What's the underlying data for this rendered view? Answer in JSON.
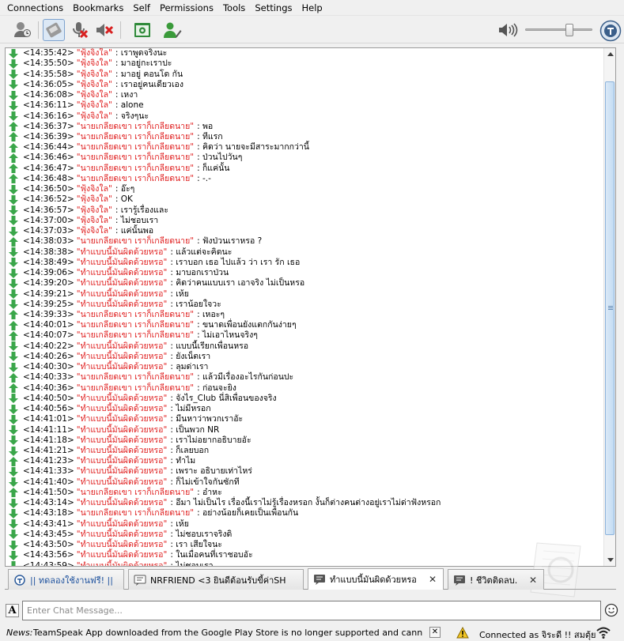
{
  "menu": [
    "Connections",
    "Bookmarks",
    "Self",
    "Permissions",
    "Tools",
    "Settings",
    "Help"
  ],
  "toolbar": {
    "buttons": [
      "away-icon",
      "push-to-talk-icon",
      "mute-mic-icon",
      "mute-speakers-icon",
      "channel-commander-icon",
      "avatar-icon"
    ],
    "volume_level": 0.68
  },
  "messages": [
    {
      "dir": "down",
      "time": "<14:35:42>",
      "nick": "\"ฟุ้งจิงใล\"",
      "text": ": เราพูดจริงนะ"
    },
    {
      "dir": "down",
      "time": "<14:35:50>",
      "nick": "\"ฟุ้งจิงใล\"",
      "text": ": มาอยู่กะเราปะ"
    },
    {
      "dir": "down",
      "time": "<14:35:58>",
      "nick": "\"ฟุ้งจิงใล\"",
      "text": ": มาอยู่ คอนโด กัน"
    },
    {
      "dir": "down",
      "time": "<14:36:05>",
      "nick": "\"ฟุ้งจิงใล\"",
      "text": ": เราอยู่คนเดียวเอง"
    },
    {
      "dir": "down",
      "time": "<14:36:08>",
      "nick": "\"ฟุ้งจิงใล\"",
      "text": ": เหงา"
    },
    {
      "dir": "down",
      "time": "<14:36:11>",
      "nick": "\"ฟุ้งจิงใล\"",
      "text": ": alone"
    },
    {
      "dir": "down",
      "time": "<14:36:16>",
      "nick": "\"ฟุ้งจิงใล\"",
      "text": ": จริงๆนะ"
    },
    {
      "dir": "up",
      "time": "<14:36:37>",
      "nick": "\"นายเกลียดเขา เราก็เกลียดนาย\"",
      "text": ": พอ"
    },
    {
      "dir": "up",
      "time": "<14:36:39>",
      "nick": "\"นายเกลียดเขา เราก็เกลียดนาย\"",
      "text": ": ทีแรก"
    },
    {
      "dir": "up",
      "time": "<14:36:44>",
      "nick": "\"นายเกลียดเขา เราก็เกลียดนาย\"",
      "text": ": คิดว่า นายจะมีสาระมากกว่านี้"
    },
    {
      "dir": "up",
      "time": "<14:36:46>",
      "nick": "\"นายเกลียดเขา เราก็เกลียดนาย\"",
      "text": ": ป่วนไปวันๆ"
    },
    {
      "dir": "up",
      "time": "<14:36:47>",
      "nick": "\"นายเกลียดเขา เราก็เกลียดนาย\"",
      "text": ": ก็แค่นั้น"
    },
    {
      "dir": "up",
      "time": "<14:36:48>",
      "nick": "\"นายเกลียดเขา เราก็เกลียดนาย\"",
      "text": ": -.-"
    },
    {
      "dir": "down",
      "time": "<14:36:50>",
      "nick": "\"ฟุ้งจิงใล\"",
      "text": ": อ๊ะๆ"
    },
    {
      "dir": "down",
      "time": "<14:36:52>",
      "nick": "\"ฟุ้งจิงใล\"",
      "text": ": OK"
    },
    {
      "dir": "down",
      "time": "<14:36:57>",
      "nick": "\"ฟุ้งจิงใล\"",
      "text": ": เรารู้เรื่องและ"
    },
    {
      "dir": "down",
      "time": "<14:37:00>",
      "nick": "\"ฟุ้งจิงใล\"",
      "text": ": ไม่ชอบเรา"
    },
    {
      "dir": "down",
      "time": "<14:37:03>",
      "nick": "\"ฟุ้งจิงใล\"",
      "text": ": แค่นั้นพอ"
    },
    {
      "dir": "up",
      "time": "<14:38:03>",
      "nick": "\"นายเกลียดเขา เราก็เกลียดนาย\"",
      "text": ": ฟังป่วนเราหรอ ?"
    },
    {
      "dir": "down",
      "time": "<14:38:38>",
      "nick": "\"ทำแบบนี้มันผิดด้วยหรอ\"",
      "text": ": แล้วแต่จะคิดนะ"
    },
    {
      "dir": "down",
      "time": "<14:38:49>",
      "nick": "\"ทำแบบนี้มันผิดด้วยหรอ\"",
      "text": ": เราบอก เธอ ไปแล้ว ว่า เรา รัก เธอ"
    },
    {
      "dir": "down",
      "time": "<14:39:06>",
      "nick": "\"ทำแบบนี้มันผิดด้วยหรอ\"",
      "text": ": มาบอกเราป่วน"
    },
    {
      "dir": "down",
      "time": "<14:39:20>",
      "nick": "\"ทำแบบนี้มันผิดด้วยหรอ\"",
      "text": ": คิดว่าคนแบบเรา เอาจริง ไม่เป็นหรอ"
    },
    {
      "dir": "down",
      "time": "<14:39:21>",
      "nick": "\"ทำแบบนี้มันผิดด้วยหรอ\"",
      "text": ": เห้ย"
    },
    {
      "dir": "down",
      "time": "<14:39:25>",
      "nick": "\"ทำแบบนี้มันผิดด้วยหรอ\"",
      "text": ": เราน้อยใจวะ"
    },
    {
      "dir": "up",
      "time": "<14:39:33>",
      "nick": "\"นายเกลียดเขา เราก็เกลียดนาย\"",
      "text": ": เหอะๆ"
    },
    {
      "dir": "up",
      "time": "<14:40:01>",
      "nick": "\"นายเกลียดเขา เราก็เกลียดนาย\"",
      "text": ": ขนาดเพื่อนยังแตกกันง่ายๆ"
    },
    {
      "dir": "up",
      "time": "<14:40:07>",
      "nick": "\"นายเกลียดเขา เราก็เกลียดนาย\"",
      "text": ": ไม่เอาไหนจริงๆ"
    },
    {
      "dir": "down",
      "time": "<14:40:22>",
      "nick": "\"ทำแบบนี้มันผิดด้วยหรอ\"",
      "text": ": แบบนี้เรียกเพื่อนหรอ"
    },
    {
      "dir": "down",
      "time": "<14:40:26>",
      "nick": "\"ทำแบบนี้มันผิดด้วยหรอ\"",
      "text": ": ยังเน็ตเรา"
    },
    {
      "dir": "down",
      "time": "<14:40:30>",
      "nick": "\"ทำแบบนี้มันผิดด้วยหรอ\"",
      "text": ": ลุมด่าเรา"
    },
    {
      "dir": "up",
      "time": "<14:40:33>",
      "nick": "\"นายเกลียดเขา เราก็เกลียดนาย\"",
      "text": ": แล้วมีเรื่องอะไรกันก่อนปะ"
    },
    {
      "dir": "up",
      "time": "<14:40:36>",
      "nick": "\"นายเกลียดเขา เราก็เกลียดนาย\"",
      "text": ": ก่อนจะยิง"
    },
    {
      "dir": "down",
      "time": "<14:40:50>",
      "nick": "\"ทำแบบนี้มันผิดด้วยหรอ\"",
      "text": ": จังไร_Club นี่สิเพื่อนของจริง"
    },
    {
      "dir": "down",
      "time": "<14:40:56>",
      "nick": "\"ทำแบบนี้มันผิดด้วยหรอ\"",
      "text": ": ไม่มีหรอก"
    },
    {
      "dir": "down",
      "time": "<14:41:01>",
      "nick": "\"ทำแบบนี้มันผิดด้วยหรอ\"",
      "text": ": มีนหาว่าพวกเราอัะ"
    },
    {
      "dir": "down",
      "time": "<14:41:11>",
      "nick": "\"ทำแบบนี้มันผิดด้วยหรอ\"",
      "text": ": เป็นพวก NR"
    },
    {
      "dir": "down",
      "time": "<14:41:18>",
      "nick": "\"ทำแบบนี้มันผิดด้วยหรอ\"",
      "text": ": เราไม่อยากอธิบายอัะ"
    },
    {
      "dir": "down",
      "time": "<14:41:21>",
      "nick": "\"ทำแบบนี้มันผิดด้วยหรอ\"",
      "text": ": ก็เลยบอก"
    },
    {
      "dir": "up",
      "time": "<14:41:23>",
      "nick": "\"ทำแบบนี้มันผิดด้วยหรอ\"",
      "text": ": ทำไม"
    },
    {
      "dir": "down",
      "time": "<14:41:33>",
      "nick": "\"ทำแบบนี้มันผิดด้วยหรอ\"",
      "text": ": เพราะ อธิบายเท่าไหร่"
    },
    {
      "dir": "down",
      "time": "<14:41:40>",
      "nick": "\"ทำแบบนี้มันผิดด้วยหรอ\"",
      "text": ": ก็ไม่เข้าใจกันซักที"
    },
    {
      "dir": "up",
      "time": "<14:41:50>",
      "nick": "\"นายเกลียดเขา เราก็เกลียดนาย\"",
      "text": ": อ๋าหะ"
    },
    {
      "dir": "down",
      "time": "<14:43:14>",
      "nick": "\"ทำแบบนี้มันผิดด้วยหรอ\"",
      "text": ": อีมา ไม่เป็นไร เรื่องนี้เราไม่รู้เรื่องหรอก งั้นก็ต่างคนต่างอยู่เราไม่ด่าฟังหรอก"
    },
    {
      "dir": "down",
      "time": "<14:43:18>",
      "nick": "\"นายเกลียดเขา เราก็เกลียดนาย\"",
      "text": ": อย่างน้อยก็เคยเป็นเพื่อนกัน"
    },
    {
      "dir": "down",
      "time": "<14:43:41>",
      "nick": "\"ทำแบบนี้มันผิดด้วยหรอ\"",
      "text": ": เห้ย"
    },
    {
      "dir": "down",
      "time": "<14:43:45>",
      "nick": "\"ทำแบบนี้มันผิดด้วยหรอ\"",
      "text": ": ไม่ชอบเราจริงดิ"
    },
    {
      "dir": "down",
      "time": "<14:43:50>",
      "nick": "\"ทำแบบนี้มันผิดด้วยหรอ\"",
      "text": ": เรา เสียใจนะ"
    },
    {
      "dir": "down",
      "time": "<14:43:56>",
      "nick": "\"ทำแบบนี้มันผิดด้วยหรอ\"",
      "text": ": ในเมื่อคนที่เราชอบอัะ"
    },
    {
      "dir": "down",
      "time": "<14:43:59>",
      "nick": "\"ทำแบบนี้มันผิดด้วยหรอ\"",
      "text": ": ไม่ชอบเรา"
    }
  ],
  "tabs": [
    {
      "label": "|| ทดลองใช้งานฟรี! ||",
      "icon": "server-icon",
      "closable": false,
      "active": false
    },
    {
      "label": "NRFRIEND <3 ยินดีต้อนรับขี้ค่าSH",
      "icon": "channel-icon",
      "closable": false,
      "active": false
    },
    {
      "label": "ทำแบบนี้มันผิดด้วยหรอ",
      "icon": "private-chat-icon",
      "closable": true,
      "active": true
    },
    {
      "label": "! ชีวิตติดลบ.",
      "icon": "private-chat-icon",
      "closable": true,
      "active": false
    }
  ],
  "input": {
    "placeholder": "Enter Chat Message..."
  },
  "status": {
    "news_label": "News:",
    "news_text": "TeamSpeak App downloaded from the Google Play Store is no longer supported and cannot connect to",
    "connection": "Connected as จิระดี !! สมตุ้ย"
  },
  "colors": {
    "nick": "#e02020",
    "arrow_green": "#3aa64a",
    "link_blue": "#1b4f9c"
  }
}
